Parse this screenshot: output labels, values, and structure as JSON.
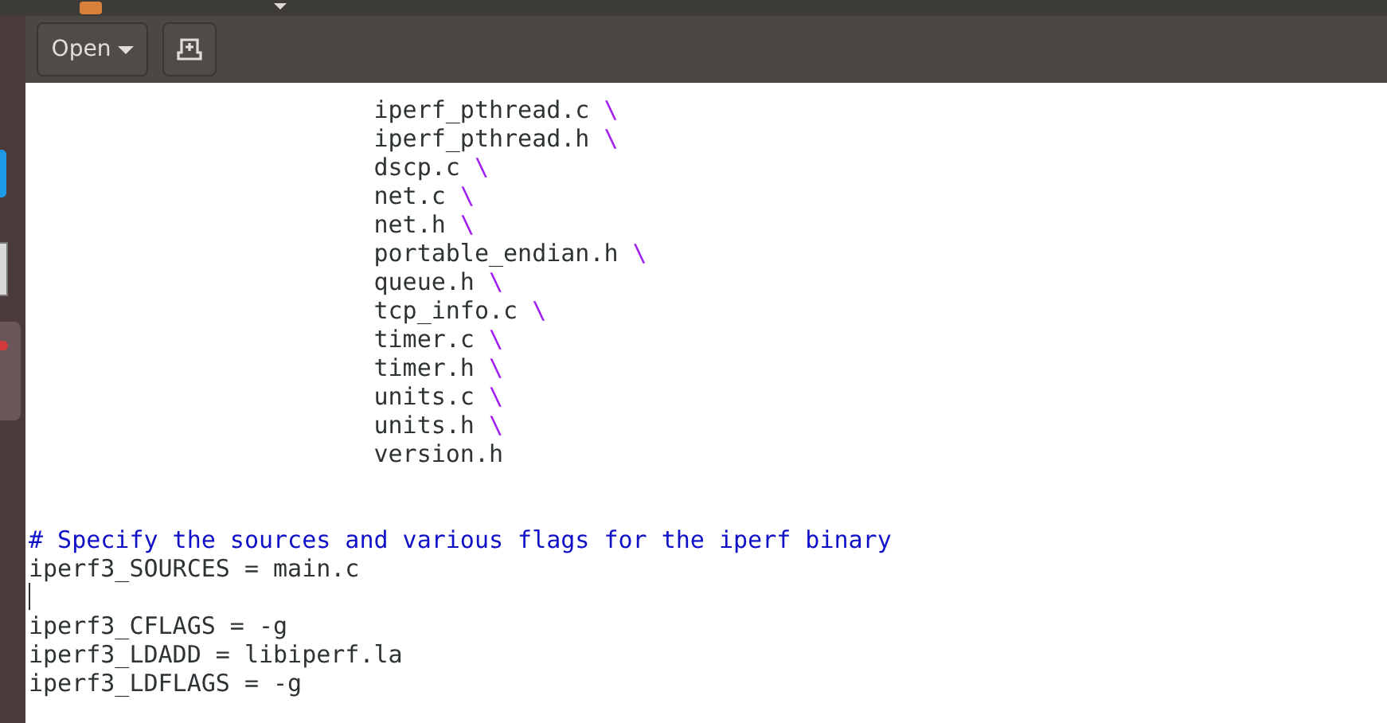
{
  "toolbar": {
    "open_button": "Open"
  },
  "editor": {
    "lines": [
      {
        "kind": "code",
        "text": "                        iperf_pthread.c",
        "continuation": "\\"
      },
      {
        "kind": "code",
        "text": "                        iperf_pthread.h",
        "continuation": "\\"
      },
      {
        "kind": "code",
        "text": "                        dscp.c",
        "continuation": "\\"
      },
      {
        "kind": "code",
        "text": "                        net.c",
        "continuation": "\\"
      },
      {
        "kind": "code",
        "text": "                        net.h",
        "continuation": "\\"
      },
      {
        "kind": "code",
        "text": "                        portable_endian.h",
        "continuation": "\\"
      },
      {
        "kind": "code",
        "text": "                        queue.h",
        "continuation": "\\"
      },
      {
        "kind": "code",
        "text": "                        tcp_info.c",
        "continuation": "\\"
      },
      {
        "kind": "code",
        "text": "                        timer.c",
        "continuation": "\\"
      },
      {
        "kind": "code",
        "text": "                        timer.h",
        "continuation": "\\"
      },
      {
        "kind": "code",
        "text": "                        units.c",
        "continuation": "\\"
      },
      {
        "kind": "code",
        "text": "                        units.h",
        "continuation": "\\"
      },
      {
        "kind": "code",
        "text": "                        version.h"
      },
      {
        "kind": "blank"
      },
      {
        "kind": "blank"
      },
      {
        "kind": "comment",
        "text": "# Specify the sources and various flags for the iperf binary"
      },
      {
        "kind": "code",
        "text": "iperf3_SOURCES = main.c"
      },
      {
        "kind": "blank",
        "cursor": true
      },
      {
        "kind": "code",
        "text": "iperf3_CFLAGS = -g"
      },
      {
        "kind": "code",
        "text": "iperf3_LDADD = libiperf.la"
      },
      {
        "kind": "code",
        "text": "iperf3_LDFLAGS = -g"
      }
    ]
  }
}
